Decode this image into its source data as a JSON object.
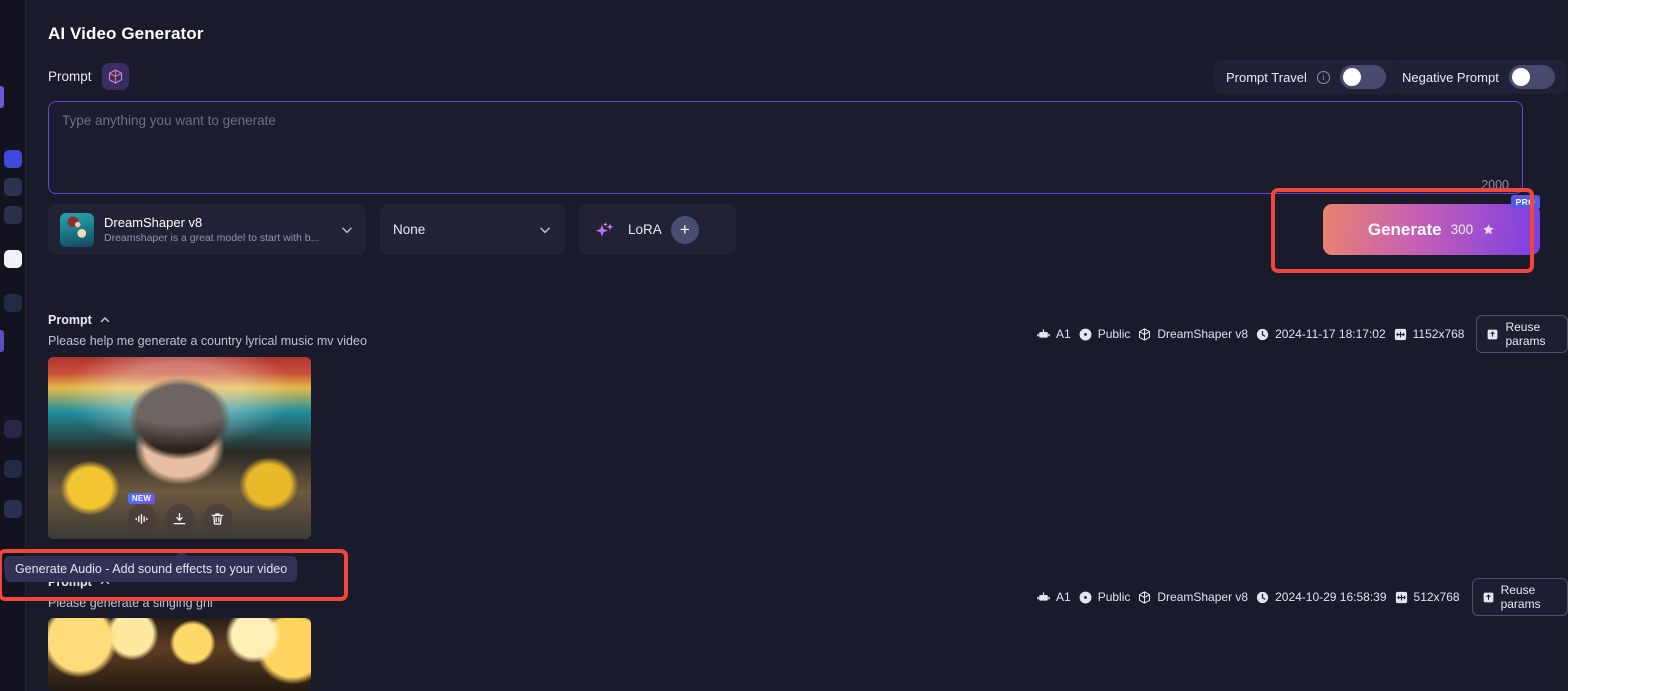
{
  "window": {
    "title": "AI Video Generator"
  },
  "prompt_section": {
    "label": "Prompt",
    "dice_icon": "dice-3d-icon",
    "placeholder": "Type anything you want to generate",
    "value": "",
    "max_chars": "2000"
  },
  "toggles": [
    {
      "label": "Prompt Travel",
      "has_info": true,
      "info_icon": "info-icon",
      "state": "off"
    },
    {
      "label": "Negative Prompt",
      "has_info": false,
      "state": "off"
    }
  ],
  "model_selector": {
    "name": "DreamShaper v8",
    "description": "Dreamshaper is a great model to start with b...",
    "chevron_icon": "chevron-down-icon"
  },
  "style_selector": {
    "value": "None",
    "chevron_icon": "chevron-down-icon"
  },
  "lora_selector": {
    "label": "LoRA",
    "sparkle_icon": "sparkles-icon",
    "add_icon": "plus-icon",
    "add_label": "+"
  },
  "generate_button": {
    "label": "Generate",
    "cost": "300",
    "cost_icon": "star-icon",
    "badge": "PRO"
  },
  "tooltip": {
    "text": "Generate Audio - Add sound effects to your video"
  },
  "thumbnail_actions": {
    "audio": {
      "icon": "audio-waveform-icon",
      "badge": "NEW"
    },
    "download": {
      "icon": "download-icon"
    },
    "delete": {
      "icon": "trash-icon"
    }
  },
  "results": [
    {
      "prompt_label": "Prompt",
      "collapse_icon": "chevron-up-icon",
      "prompt_text": "Please help me generate a country lyrical music mv video",
      "meta": {
        "engine_icon": "robot-icon",
        "engine": "A1",
        "visibility_icon": "eye-icon",
        "visibility": "Public",
        "model_icon": "cube-icon",
        "model": "DreamShaper v8",
        "time_icon": "clock-icon",
        "time": "2024-11-17 18:17:02",
        "size_icon": "resize-icon",
        "size": "1152x768",
        "reuse_icon": "reuse-icon",
        "reuse_label": "Reuse params"
      }
    },
    {
      "prompt_label": "Prompt",
      "collapse_icon": "chevron-up-icon",
      "prompt_text": "Please generate a singing gril",
      "meta": {
        "engine_icon": "robot-icon",
        "engine": "A1",
        "visibility_icon": "eye-icon",
        "visibility": "Public",
        "model_icon": "cube-icon",
        "model": "DreamShaper v8",
        "time_icon": "clock-icon",
        "time": "2024-10-29 16:58:39",
        "size_icon": "resize-icon",
        "size": "512x768",
        "reuse_icon": "reuse-icon",
        "reuse_label": "Reuse params"
      }
    }
  ],
  "colors": {
    "accent_purple": "#6b3fe0",
    "annotation_red": "#f0463c",
    "panel_bg": "#191a2a",
    "card_bg": "#212236"
  }
}
